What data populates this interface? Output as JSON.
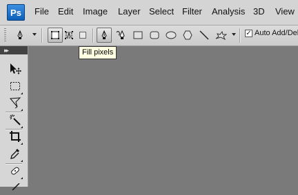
{
  "menubar": {
    "logo_text": "Ps",
    "items": [
      "File",
      "Edit",
      "Image",
      "Layer",
      "Select",
      "Filter",
      "Analysis",
      "3D",
      "View"
    ]
  },
  "options_bar": {
    "preset_icon": "pen-tool-icon",
    "mode_buttons": [
      "shape-layers-icon",
      "paths-icon",
      "fill-pixels-icon"
    ],
    "draw_tools": [
      "pen-tool-icon",
      "freeform-pen-icon",
      "rectangle-icon",
      "rounded-rectangle-icon",
      "ellipse-icon",
      "polygon-icon",
      "line-icon",
      "custom-shape-icon"
    ],
    "auto_add_delete_label": "Auto Add/Dele",
    "auto_add_delete_checked": true
  },
  "tooltip": {
    "text": "Fill pixels"
  },
  "toolbox": {
    "collapse_icon": "double-chevron-icon",
    "tools": [
      "move-tool-icon",
      "marquee-tool-icon",
      "lasso-tool-icon",
      "magic-wand-icon",
      "crop-tool-icon",
      "eyedropper-icon",
      "healing-brush-icon",
      "brush-tool-icon"
    ]
  },
  "colors": {
    "canvas": "#7a7a7a",
    "menubar": "#d4d4d4",
    "tooltip_bg": "#ffffe1",
    "logo_blue": "#1f72cc"
  }
}
